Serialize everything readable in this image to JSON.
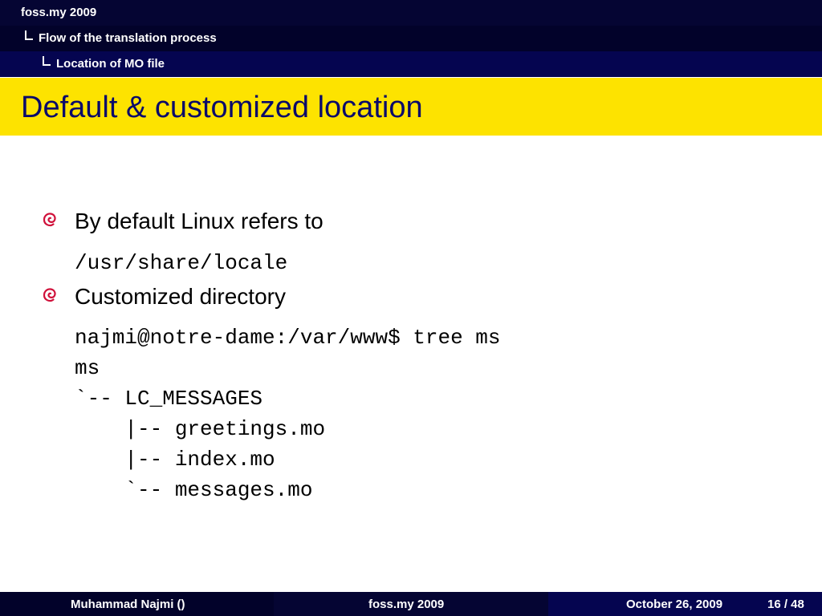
{
  "header": {
    "section": "foss.my 2009",
    "subsection": "Flow of the translation process",
    "subsubsection": "Location of MO file"
  },
  "slide": {
    "title": "Default & customized location",
    "bullets": [
      {
        "text": "By default Linux refers to",
        "code": [
          "/usr/share/locale"
        ]
      },
      {
        "text": "Customized directory",
        "code": [
          "najmi@notre-dame:/var/www$ tree ms",
          "ms",
          "`-- LC_MESSAGES",
          "    |-- greetings.mo",
          "    |-- index.mo",
          "    `-- messages.mo"
        ]
      }
    ]
  },
  "footer": {
    "author": "Muhammad Najmi  ()",
    "event": "foss.my 2009",
    "date": "October 26, 2009",
    "page": "16 / 48"
  },
  "colors": {
    "title_bar": "#fde300",
    "title_text": "#0a0a6a",
    "nav_dark": "#050533",
    "bullet_icon": "#d0103a"
  },
  "icons": {
    "bullet": "debian-swirl-icon"
  }
}
